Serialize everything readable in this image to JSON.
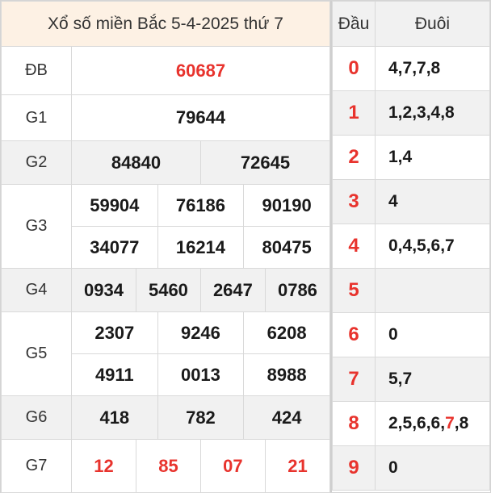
{
  "title": "Xổ số miền Bắc 5-4-2025 thứ 7",
  "prizes": {
    "db": {
      "label": "ĐB",
      "numbers": [
        "60687"
      ]
    },
    "g1": {
      "label": "G1",
      "numbers": [
        "79644"
      ]
    },
    "g2": {
      "label": "G2",
      "numbers": [
        "84840",
        "72645"
      ]
    },
    "g3": {
      "label": "G3",
      "numbers": [
        "59904",
        "76186",
        "90190",
        "34077",
        "16214",
        "80475"
      ]
    },
    "g4": {
      "label": "G4",
      "numbers": [
        "0934",
        "5460",
        "2647",
        "0786"
      ]
    },
    "g5": {
      "label": "G5",
      "numbers": [
        "2307",
        "9246",
        "6208",
        "4911",
        "0013",
        "8988"
      ]
    },
    "g6": {
      "label": "G6",
      "numbers": [
        "418",
        "782",
        "424"
      ]
    },
    "g7": {
      "label": "G7",
      "numbers": [
        "12",
        "85",
        "07",
        "21"
      ]
    }
  },
  "loto": {
    "header_dau": "Đầu",
    "header_duoi": "Đuôi",
    "rows": [
      {
        "dau": "0",
        "duoi": "4,7,7,8"
      },
      {
        "dau": "1",
        "duoi": "1,2,3,4,8"
      },
      {
        "dau": "2",
        "duoi": "1,4"
      },
      {
        "dau": "3",
        "duoi": "4"
      },
      {
        "dau": "4",
        "duoi": "0,4,5,6,7"
      },
      {
        "dau": "5",
        "duoi": ""
      },
      {
        "dau": "6",
        "duoi": "0"
      },
      {
        "dau": "7",
        "duoi": "5,7"
      },
      {
        "dau": "8",
        "duoi_parts": [
          "2,5,6,6,",
          "7",
          ",8"
        ]
      },
      {
        "dau": "9",
        "duoi": "0"
      }
    ]
  },
  "colors": {
    "accent_red": "#e8332d",
    "header_bg": "#fdf1e4",
    "shade_bg": "#f1f1f1"
  }
}
